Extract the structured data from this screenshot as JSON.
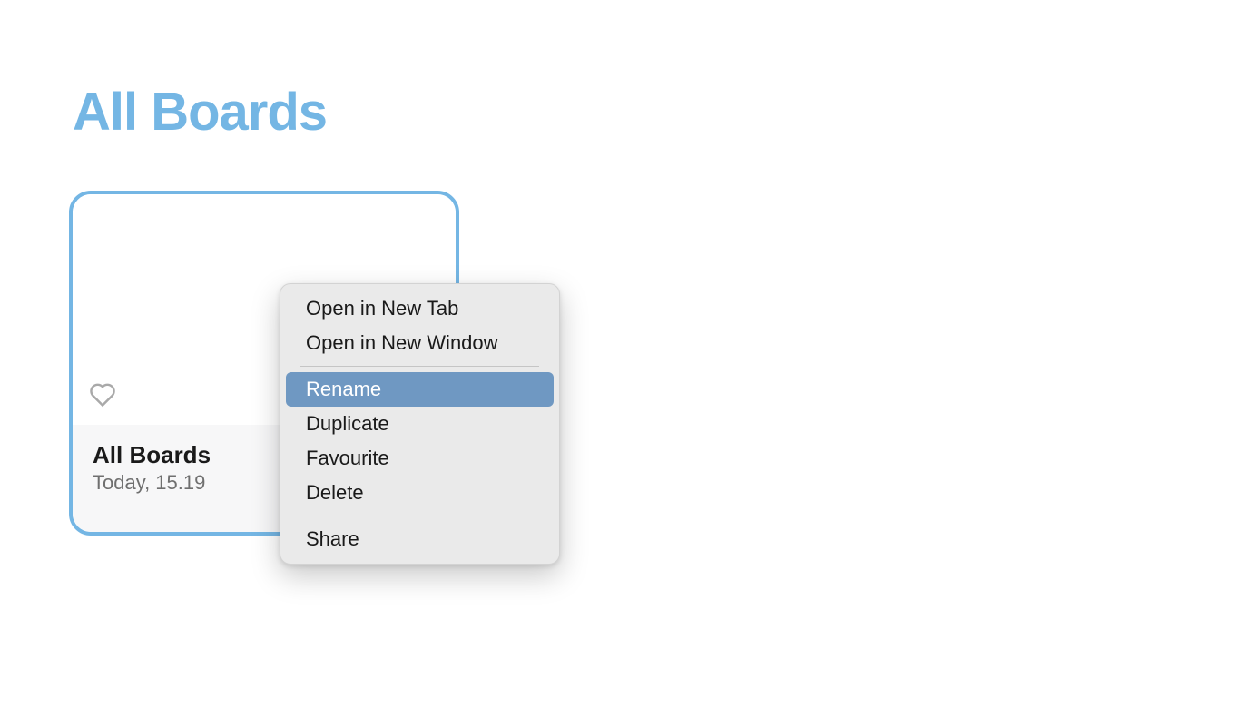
{
  "header": {
    "title": "All Boards"
  },
  "board": {
    "name": "All Boards",
    "date": "Today, 15.19"
  },
  "contextMenu": {
    "items": [
      {
        "label": "Open in New Tab",
        "type": "item"
      },
      {
        "label": "Open in New Window",
        "type": "item"
      },
      {
        "type": "separator"
      },
      {
        "label": "Rename",
        "type": "item",
        "highlighted": true
      },
      {
        "label": "Duplicate",
        "type": "item"
      },
      {
        "label": "Favourite",
        "type": "item"
      },
      {
        "label": "Delete",
        "type": "item"
      },
      {
        "type": "separator"
      },
      {
        "label": "Share",
        "type": "item"
      }
    ]
  }
}
